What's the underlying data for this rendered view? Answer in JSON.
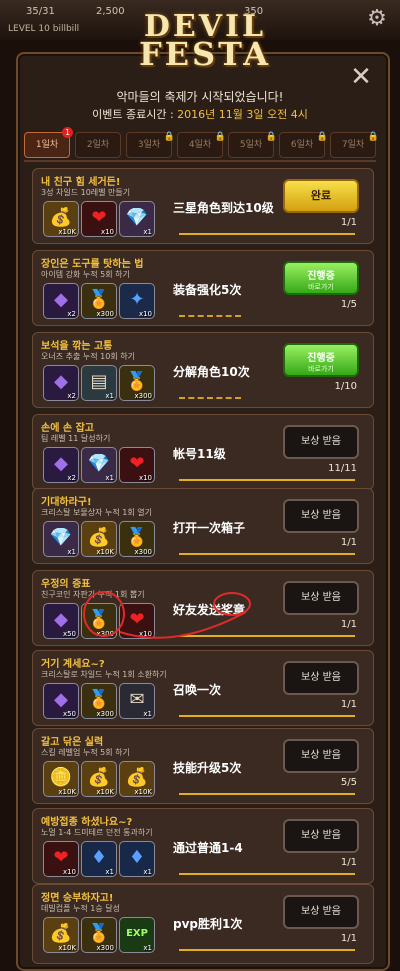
{
  "topbar": {
    "res1": "35/31",
    "res2": "2,500",
    "res3": "350",
    "level_prefix": "LEVEL 10",
    "user": "billbill"
  },
  "logo": {
    "line1": "DEVIL",
    "line2": "FESTA"
  },
  "header": {
    "subtitle": "악마들의 축제가 시작되었습니다!",
    "end_label": "이벤트 종료시간 : ",
    "end_value": "2016년 11월 3일 오전 4시"
  },
  "tabs": [
    {
      "label": "1일차",
      "active": true,
      "locked": false,
      "badge": "1"
    },
    {
      "label": "2일차",
      "active": false,
      "locked": false
    },
    {
      "label": "3일차",
      "active": false,
      "locked": true
    },
    {
      "label": "4일차",
      "active": false,
      "locked": true
    },
    {
      "label": "5일차",
      "active": false,
      "locked": true
    },
    {
      "label": "6일차",
      "active": false,
      "locked": true
    },
    {
      "label": "7일차",
      "active": false,
      "locked": true
    }
  ],
  "quests": [
    {
      "title": "내 친구 힘 세거든!",
      "desc": "3성 차일드 10레벨 만들기",
      "note": "三星角色到达10级",
      "progress": "1/1",
      "fill": 1.0,
      "button": {
        "type": "claim",
        "label": "완료"
      },
      "rewards": [
        {
          "icon": "gold-pile-icon",
          "count": "x10K"
        },
        {
          "icon": "heart-icon",
          "count": "x10"
        },
        {
          "icon": "rainbow-crystal-icon",
          "count": "x1"
        }
      ]
    },
    {
      "title": "장인은 도구를 탓하는 법",
      "desc": "아이템 강화 누적 5회 하기",
      "note": "装备强化5次",
      "progress": "1/5",
      "fill": 0.2,
      "button": {
        "type": "go",
        "label": "진행중",
        "sub": "바로가기"
      },
      "rewards": [
        {
          "icon": "purple-crystal-icon",
          "count": "x2"
        },
        {
          "icon": "medal-icon",
          "count": "x300"
        },
        {
          "icon": "blue-orb-icon",
          "count": "x10"
        }
      ]
    },
    {
      "title": "보석을 깎는 고통",
      "desc": "오너즈 추출 누적 10회 하기",
      "note": "分解角色10次",
      "progress": "1/10",
      "fill": 0.1,
      "button": {
        "type": "go",
        "label": "진행중",
        "sub": "바로가기"
      },
      "rewards": [
        {
          "icon": "purple-crystal-icon",
          "count": "x2"
        },
        {
          "icon": "card-icon",
          "count": "x1"
        },
        {
          "icon": "medal-icon",
          "count": "x300"
        }
      ]
    },
    {
      "title": "손에 손 잡고",
      "desc": "팀 레벨 11 달성하기",
      "note": "帐号11级",
      "progress": "11/11",
      "fill": 1.0,
      "button": {
        "type": "reward",
        "label": "보상 받음"
      },
      "rewards": [
        {
          "icon": "purple-crystal-icon",
          "count": "x2"
        },
        {
          "icon": "rainbow-crystal-icon",
          "count": "x1"
        },
        {
          "icon": "heart-icon",
          "count": "x10"
        }
      ]
    },
    {
      "title": "기대하라구!",
      "desc": "크리스탈 보물상자 누적 1회 열기",
      "note": "打开一次箱子",
      "progress": "1/1",
      "fill": 1.0,
      "button": {
        "type": "reward",
        "label": "보상 받음"
      },
      "rewards": [
        {
          "icon": "rainbow-crystal-icon",
          "count": "x1"
        },
        {
          "icon": "gold-pile-icon",
          "count": "x10K"
        },
        {
          "icon": "medal-icon",
          "count": "x300"
        }
      ]
    },
    {
      "title": "우정의 증표",
      "desc": "친구코인 자판기 누적 1회 뽑기",
      "note": "好友发送奖章",
      "progress": "1/1",
      "fill": 1.0,
      "button": {
        "type": "reward",
        "label": "보상 받음"
      },
      "rewards": [
        {
          "icon": "purple-crystal-icon",
          "count": "x50"
        },
        {
          "icon": "medal-icon",
          "count": "x300"
        },
        {
          "icon": "heart-icon",
          "count": "x10"
        }
      ]
    },
    {
      "title": "거기 계세요~?",
      "desc": "크리스탈로 차일드 누적 1회 소환하기",
      "note": "召唤一次",
      "progress": "1/1",
      "fill": 1.0,
      "button": {
        "type": "reward",
        "label": "보상 받음"
      },
      "rewards": [
        {
          "icon": "purple-crystal-icon",
          "count": "x50"
        },
        {
          "icon": "medal-icon",
          "count": "x300"
        },
        {
          "icon": "scroll-icon",
          "count": "x1"
        }
      ]
    },
    {
      "title": "갈고 닦은 실력",
      "desc": "스킬 레벨업 누적 5회 하기",
      "note": "技能升级5次",
      "progress": "5/5",
      "fill": 1.0,
      "button": {
        "type": "reward",
        "label": "보상 받음"
      },
      "rewards": [
        {
          "icon": "gold-coin-icon",
          "count": "x10K"
        },
        {
          "icon": "gold-pile-icon",
          "count": "x10K"
        },
        {
          "icon": "gold-pile-icon",
          "count": "x10K"
        }
      ]
    },
    {
      "title": "예방접종 하셨나요~?",
      "desc": "노멀 1-4 드미테르 던전 통과하기",
      "note": "通过普通1-4",
      "progress": "1/1",
      "fill": 1.0,
      "button": {
        "type": "reward",
        "label": "보상 받음"
      },
      "rewards": [
        {
          "icon": "heart-icon",
          "count": "x10"
        },
        {
          "icon": "blue-gem-icon",
          "count": "x1"
        },
        {
          "icon": "blue-gem-icon",
          "count": "x1"
        }
      ]
    },
    {
      "title": "정면 승부하자고!",
      "desc": "데빌컵플 누적 1승 달성",
      "note": "pvp胜利1次",
      "progress": "1/1",
      "fill": 1.0,
      "button": {
        "type": "reward",
        "label": "보상 받음"
      },
      "rewards": [
        {
          "icon": "gold-pile-icon",
          "count": "x10K"
        },
        {
          "icon": "medal-icon",
          "count": "x300"
        },
        {
          "icon": "exp-icon",
          "count": "x1"
        }
      ]
    }
  ],
  "colors": {
    "accent": "#f4c040",
    "panel": "#2b1e16",
    "card": "#3a2a22",
    "annotation": "#e02a2a"
  }
}
